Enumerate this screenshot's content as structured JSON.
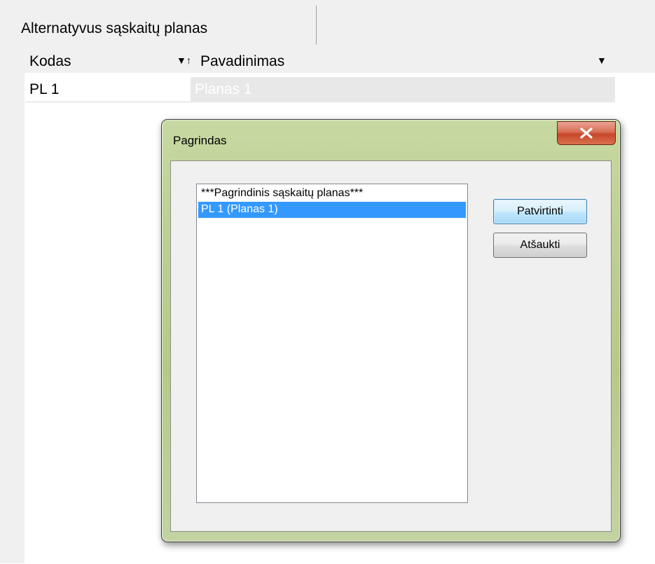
{
  "tab": {
    "label": "Alternatyvus sąskaitų planas"
  },
  "grid": {
    "columns": [
      {
        "label": "Kodas",
        "sort_icon": "▼↑"
      },
      {
        "label": "Pavadinimas",
        "sort_icon": "▼"
      }
    ],
    "rows": [
      {
        "kodas": "PL 1",
        "pavadinimas": "Planas 1"
      }
    ]
  },
  "dialog": {
    "title": "Pagrindas",
    "close_icon": "close-icon",
    "list_items": [
      "***Pagrindinis sąskaitų planas***",
      "PL 1 (Planas 1)"
    ],
    "selected_index": 1,
    "ok_label": "Patvirtinti",
    "cancel_label": "Atšaukti"
  },
  "colors": {
    "selection": "#3399ff",
    "dialog_frame": "#bccf93",
    "close_button": "#c7462a"
  }
}
